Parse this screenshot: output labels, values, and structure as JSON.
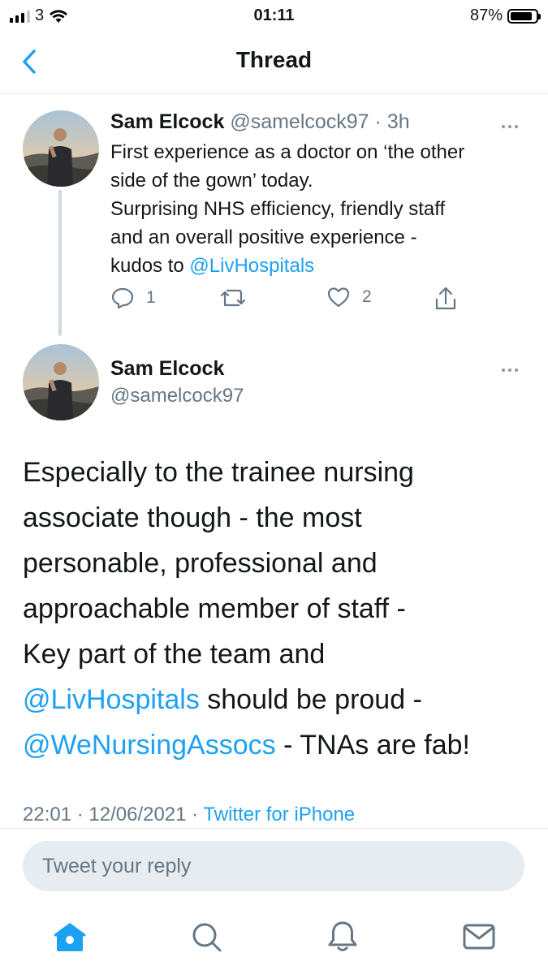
{
  "status_bar": {
    "carrier": "3",
    "time": "01:11",
    "battery_percent": "87%",
    "battery_level": 0.87
  },
  "nav": {
    "title": "Thread",
    "back_icon": "chevron-left-icon"
  },
  "tweet1": {
    "name": "Sam Elcock",
    "handle": "@samelcock97",
    "separator": "·",
    "time": "3h",
    "text_lines": [
      "First experience as a doctor on ‘the other",
      "side of the gown’ today.",
      "Surprising NHS efficiency, friendly staff",
      "and an overall positive experience -",
      "kudos to "
    ],
    "mention": "@LivHospitals",
    "reply_count": "1",
    "like_count": "2"
  },
  "tweet2": {
    "name": "Sam Elcock",
    "handle": "@samelcock97",
    "text_lines": [
      "Especially to the trainee nursing",
      "associate though - the most",
      "personable, professional and",
      "approachable member of staff -",
      "Key part of the team and"
    ],
    "line6_mention": "@LivHospitals",
    "line6_rest": " should be proud -",
    "line7_mention": "@WeNursingAssocs",
    "line7_rest": " - TNAs are fab!",
    "timestamp": "22:01 · 12/06/2021 · ",
    "source": "Twitter for iPhone"
  },
  "reply": {
    "placeholder": "Tweet your reply"
  },
  "tab_bar": {
    "icons": [
      "home-icon",
      "search-icon",
      "notifications-icon",
      "messages-icon"
    ]
  },
  "colors": {
    "accent": "#1da1f2",
    "muted_text": "#657786",
    "primary_text": "#14171a"
  }
}
